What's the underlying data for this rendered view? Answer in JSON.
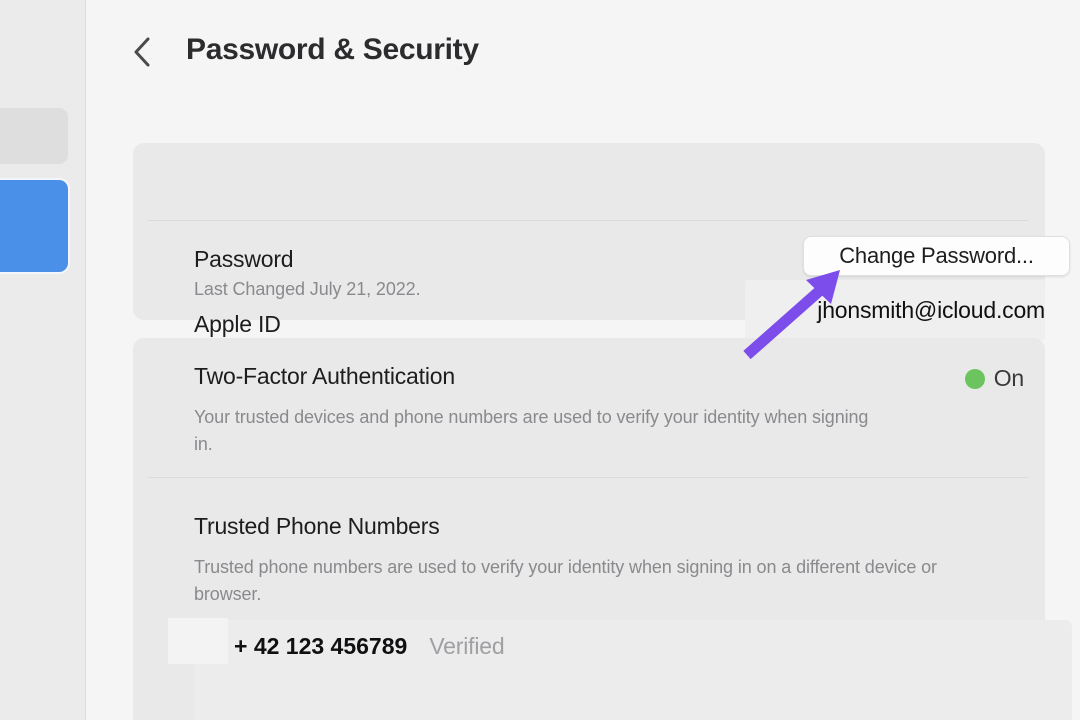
{
  "window": {
    "background_color": "#f5f5f5",
    "sidebar_color": "#ebebeb",
    "accent_color": "#4a90e8",
    "annotation_color": "#7c4dea"
  },
  "sidebar": {
    "items": [
      {
        "name": "sidebar-pill-inactive",
        "state": "inactive",
        "color": "#dedede"
      },
      {
        "name": "sidebar-pill-active",
        "state": "selected",
        "color": "#4a90e8"
      }
    ]
  },
  "header": {
    "back_icon": "chevron-left-icon",
    "title": "Password & Security"
  },
  "account_card": {
    "apple_id": {
      "label": "Apple ID",
      "value": "jhonsmith@icloud.com"
    },
    "password": {
      "label": "Password",
      "sub_label": "Last Changed July 21, 2022.",
      "button_label": "Change Password..."
    }
  },
  "security_card": {
    "two_factor": {
      "label": "Two-Factor Authentication",
      "status_text": "On",
      "status_color": "#6cc45f",
      "description": "Your trusted devices and phone numbers are used to verify your identity when signing in."
    },
    "trusted_numbers": {
      "label": "Trusted Phone Numbers",
      "description": "Trusted phone numbers are used to verify your identity when signing in on a different device or browser.",
      "rows": [
        {
          "number": "+ 42 123 456789",
          "status": "Verified"
        }
      ]
    }
  },
  "annotation": {
    "name": "arrow-pointing-to-change-password",
    "color": "#7c4dea"
  }
}
